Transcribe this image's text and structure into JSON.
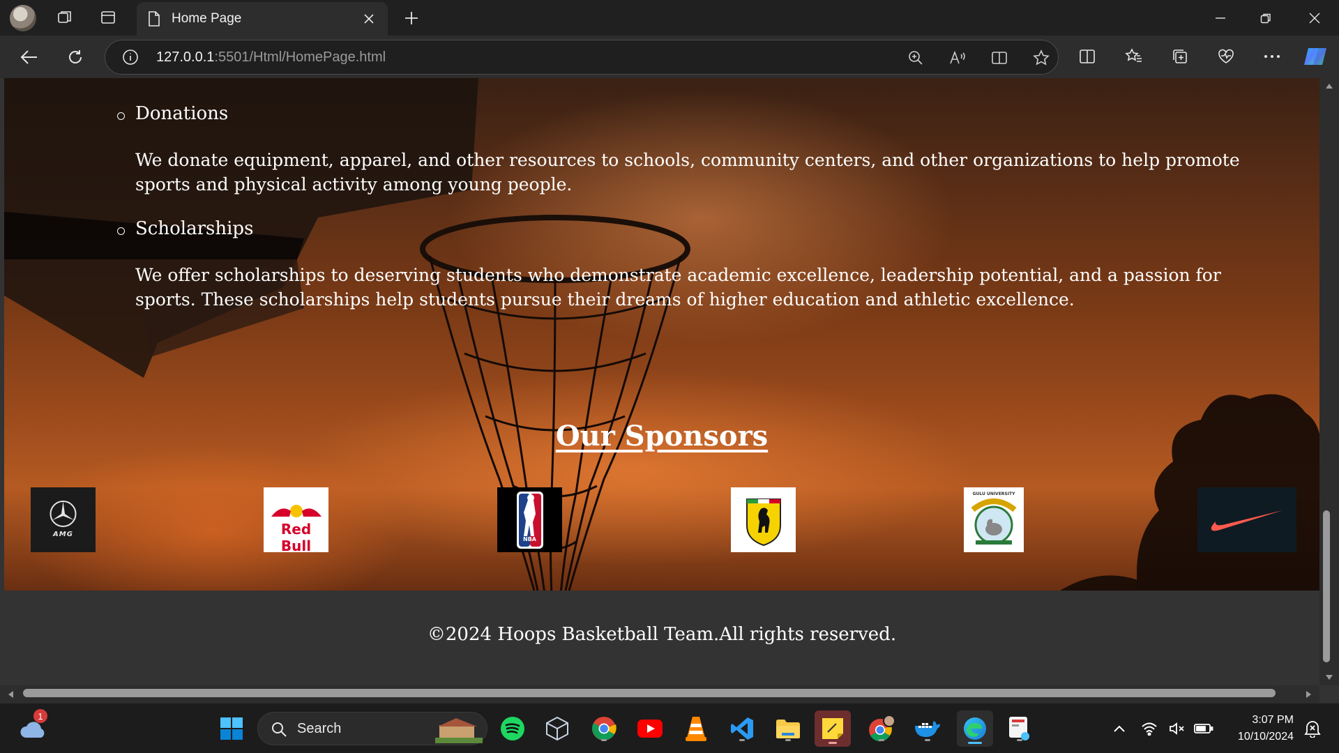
{
  "browser": {
    "tab_title": "Home Page",
    "url_host": "127.0.0.1",
    "url_path": ":5501/Html/HomePage.html"
  },
  "page": {
    "donations_title": "Donations",
    "donations_text": "We donate equipment, apparel, and other resources to schools, community centers, and other organizations to help promote sports and physical activity among young people.",
    "scholarships_title": "Scholarships",
    "scholarships_text": "We offer scholarships to deserving students who demonstrate academic excellence, leadership potential, and a passion for sports. These scholarships help students pursue their dreams of higher education and athletic excellence.",
    "sponsors_title": "Our Sponsors",
    "sponsors": [
      {
        "text": "AMG"
      },
      {
        "text": "Red Bull"
      },
      {
        "text": "NBA"
      },
      {
        "text": ""
      },
      {
        "text": "GULU UNIVERSITY"
      },
      {
        "text": ""
      }
    ],
    "footer": "©2024 Hoops Basketball Team.All rights reserved."
  },
  "taskbar": {
    "search_label": "Search",
    "time": "3:07 PM",
    "date": "10/10/2024",
    "weather_badge": "1"
  },
  "colors": {
    "footer_bg": "#333333",
    "chrome_bg": "#202020",
    "toolbar_bg": "#2d2d2d"
  }
}
